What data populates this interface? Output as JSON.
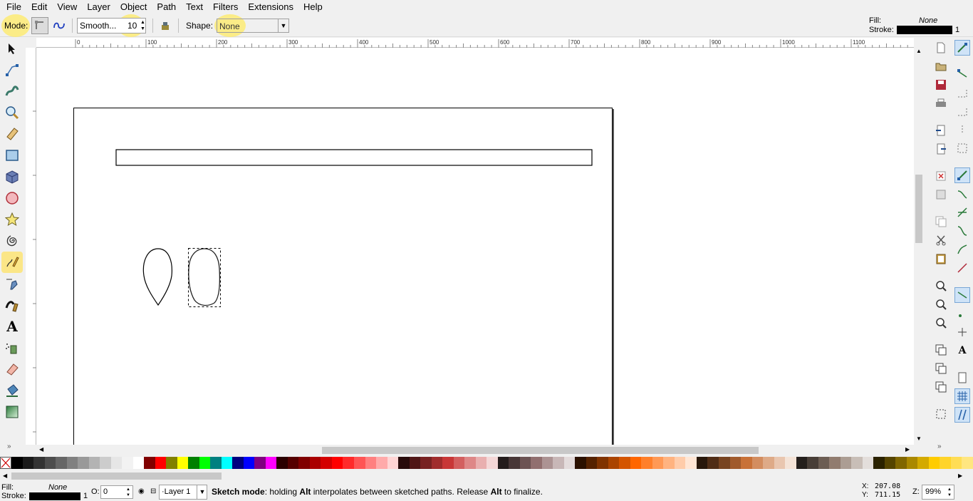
{
  "menu": [
    "File",
    "Edit",
    "View",
    "Layer",
    "Object",
    "Path",
    "Text",
    "Filters",
    "Extensions",
    "Help"
  ],
  "toolbar": {
    "mode_label": "Mode:",
    "smoothing_label": "Smooth...",
    "smoothing_value": "10",
    "shape_label": "Shape:",
    "shape_value": "None"
  },
  "style_indicator": {
    "fill_label": "Fill:",
    "fill_value": "None",
    "stroke_label": "Stroke:",
    "stroke_width": "1"
  },
  "ruler": {
    "h_ticks": [
      "0",
      "100",
      "200",
      "300",
      "400",
      "500",
      "600",
      "700",
      "800",
      "900",
      "1000",
      "1100"
    ]
  },
  "status": {
    "fill_label": "Fill:",
    "fill_value": "None",
    "stroke_label": "Stroke:",
    "stroke_width": "1",
    "opacity_label": "O:",
    "opacity_value": "0",
    "layer_name": "Layer 1",
    "message_bold1": "Sketch mode",
    "message_part1": ": holding ",
    "message_bold2": "Alt",
    "message_part2": " interpolates between sketched paths. Release ",
    "message_bold3": "Alt",
    "message_part3": " to finalize.",
    "x_label": "X:",
    "x_value": "207.08",
    "y_label": "Y:",
    "y_value": "711.15",
    "zoom_label": "Z:",
    "zoom_value": "99%"
  },
  "palette": [
    "#000000",
    "#1a1a1a",
    "#333333",
    "#4d4d4d",
    "#666666",
    "#808080",
    "#999999",
    "#b3b3b3",
    "#cccccc",
    "#e6e6e6",
    "#f2f2f2",
    "#ffffff",
    "#800000",
    "#ff0000",
    "#808000",
    "#ffff00",
    "#008000",
    "#00ff00",
    "#008080",
    "#00ffff",
    "#000080",
    "#0000ff",
    "#800080",
    "#ff00ff",
    "#2b0000",
    "#550000",
    "#800000",
    "#aa0000",
    "#d40000",
    "#ff0000",
    "#ff2a2a",
    "#ff5555",
    "#ff8080",
    "#ffaaaa",
    "#ffd5d5",
    "#280b0b",
    "#501616",
    "#782121",
    "#a02c2c",
    "#c83737",
    "#d35f5f",
    "#de8787",
    "#e9afaf",
    "#f4d7d7",
    "#241c1c",
    "#483737",
    "#6c5353",
    "#916f6f",
    "#ac9393",
    "#c8b7b7",
    "#e3dbdb",
    "#2b1100",
    "#552200",
    "#803300",
    "#aa4400",
    "#d45500",
    "#ff6600",
    "#ff7f2a",
    "#ff9955",
    "#ffb380",
    "#ffccaa",
    "#ffe6d5",
    "#28170b",
    "#502d16",
    "#784421",
    "#a05a2c",
    "#c87137",
    "#d38d5f",
    "#deaa87",
    "#e9c6af",
    "#f4e3d7",
    "#241f1c",
    "#483e37",
    "#6c5d53",
    "#917c6f",
    "#ac9d93",
    "#c8beb7",
    "#e3dedb",
    "#2b2200",
    "#554400",
    "#806600",
    "#aa8800",
    "#d4aa00",
    "#ffcc00",
    "#ffd42a",
    "#ffdd55",
    "#ffe680"
  ]
}
